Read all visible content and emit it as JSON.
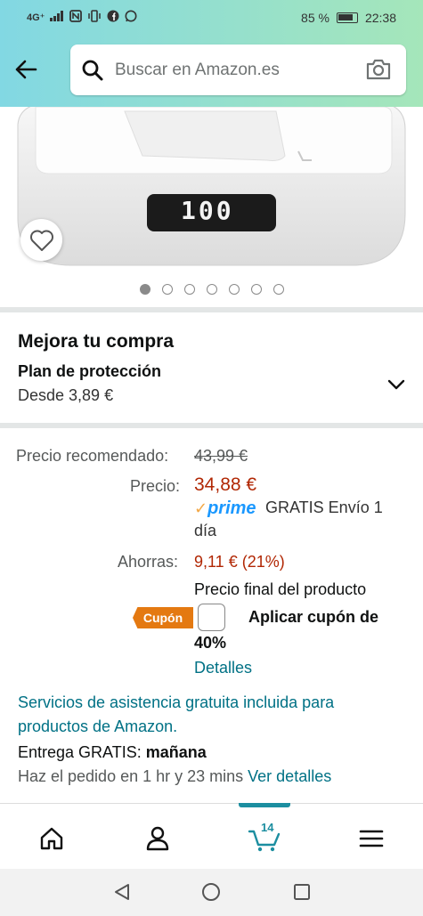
{
  "status_bar": {
    "network": "4G⁺",
    "battery": "85 %",
    "time": "22:38"
  },
  "search": {
    "placeholder": "Buscar en Amazon.es"
  },
  "product_image": {
    "display_text": "100",
    "dots_total": 7,
    "active_dot": 0
  },
  "upgrade": {
    "title": "Mejora tu compra",
    "plan_title": "Plan de protección",
    "plan_price": "Desde 3,89 €"
  },
  "pricing": {
    "recommended_label": "Precio recomendado:",
    "recommended_value": "43,99 €",
    "price_label": "Precio:",
    "price_value": "34,88 €",
    "prime_word": "prime",
    "shipping_line1": "GRATIS Envío 1",
    "shipping_line2": "día",
    "savings_label": "Ahorras:",
    "savings_value": "9,11 € (21%)",
    "final_price_text": "Precio final del producto",
    "coupon_badge": "Cupón",
    "coupon_text_line1": "Aplicar cupón de",
    "coupon_text_line2": "40%",
    "details_link": "Detalles"
  },
  "services_text": "Servicios de asistencia gratuita incluida para productos de Amazon.",
  "delivery": {
    "prefix": "Entrega GRATIS: ",
    "day": "mañana"
  },
  "order_by": {
    "text": "Haz el pedido en 1 hr y 23 mins ",
    "link": "Ver detalles"
  },
  "bottom_nav": {
    "cart_count": "14"
  },
  "colors": {
    "price_red": "#b12704",
    "link_teal": "#007185",
    "coupon_orange": "#e47911",
    "prime_blue": "#1a98ff",
    "nav_accent": "#1c8ea0"
  }
}
